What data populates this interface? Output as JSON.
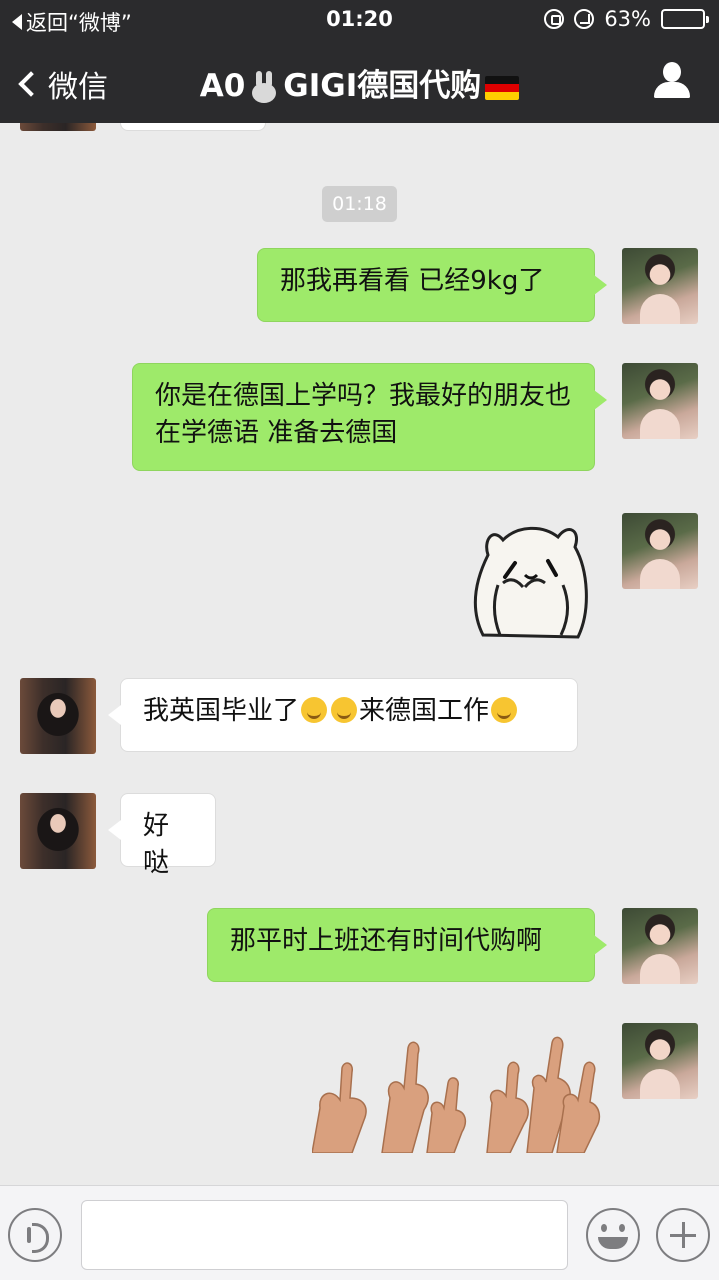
{
  "status_bar": {
    "back_label": "返回“微博”",
    "time": "01:20",
    "battery": "63%",
    "battery_level": 0.63
  },
  "nav": {
    "back_label": "微信",
    "title_prefix": "A0",
    "title_suffix": "GIGI德国代购",
    "title_icons": [
      "rabbit-emoji",
      "germany-flag"
    ],
    "profile_icon": "profile-icon"
  },
  "chat": {
    "timestamp": "01:18",
    "messages": [
      {
        "sender": "me",
        "type": "text",
        "text": "那我再看看 已经9kg了"
      },
      {
        "sender": "me",
        "type": "text",
        "text": "你是在德国上学吗？我最好的朋友也在学德语 准备去德国"
      },
      {
        "sender": "me",
        "type": "sticker",
        "sticker": "alpaca-sticker"
      },
      {
        "sender": "her",
        "type": "text",
        "text_a": "我英国毕业了",
        "text_b": "来德国工作",
        "emojis": [
          "thinking-emoji",
          "thinking-emoji",
          "grin-emoji"
        ]
      },
      {
        "sender": "her",
        "type": "text",
        "text": "好哒"
      },
      {
        "sender": "me",
        "type": "text",
        "text": "那平时上班还有时间代购啊"
      },
      {
        "sender": "me",
        "type": "sticker",
        "sticker": "thumbs-up-sticker"
      }
    ]
  },
  "input_bar": {
    "icons": [
      "voice-icon",
      "emoji-icon",
      "plus-icon"
    ],
    "placeholder": ""
  },
  "colors": {
    "nav_bg": "#2b2b2d",
    "chat_bg": "#ebebeb",
    "my_bubble": "#9eea6a",
    "their_bubble": "#ffffff"
  }
}
